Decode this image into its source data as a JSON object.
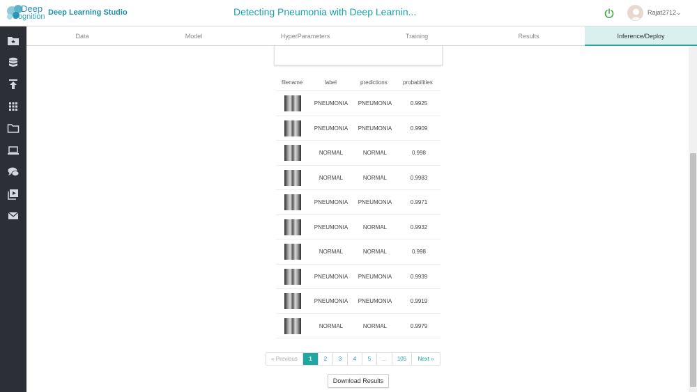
{
  "header": {
    "logo_top": "Deep",
    "logo_bottom": "Cognition",
    "studio_name": "Deep Learning Studio",
    "page_title": "Detecting Pneumonia with Deep Learnin...",
    "username": "Rajat2712",
    "caret": "⌄"
  },
  "sidebar": {
    "icons": [
      "folder-star-icon",
      "database-icon",
      "upload-icon",
      "grid-apps-icon",
      "folder-icon",
      "laptop-icon",
      "chat-icon",
      "video-play-icon",
      "mail-icon"
    ]
  },
  "tabs": {
    "items": [
      {
        "label": "Data"
      },
      {
        "label": "Model"
      },
      {
        "label": "HyperParameters"
      },
      {
        "label": "Training"
      },
      {
        "label": "Results"
      },
      {
        "label": "Inference/Deploy",
        "active": true
      }
    ]
  },
  "table": {
    "headers": [
      "filename",
      "label",
      "predictions",
      "probabilities"
    ],
    "rows": [
      {
        "label": "PNEUMONIA",
        "prediction": "PNEUMONIA",
        "probability": "0.9925"
      },
      {
        "label": "PNEUMONIA",
        "prediction": "PNEUMONIA",
        "probability": "0.9909"
      },
      {
        "label": "NORMAL",
        "prediction": "NORMAL",
        "probability": "0.998"
      },
      {
        "label": "NORMAL",
        "prediction": "NORMAL",
        "probability": "0.9983"
      },
      {
        "label": "PNEUMONIA",
        "prediction": "PNEUMONIA",
        "probability": "0.9971"
      },
      {
        "label": "PNEUMONIA",
        "prediction": "NORMAL",
        "probability": "0.9932"
      },
      {
        "label": "NORMAL",
        "prediction": "NORMAL",
        "probability": "0.998"
      },
      {
        "label": "PNEUMONIA",
        "prediction": "PNEUMONIA",
        "probability": "0.9939"
      },
      {
        "label": "PNEUMONIA",
        "prediction": "PNEUMONIA",
        "probability": "0.9919"
      },
      {
        "label": "NORMAL",
        "prediction": "NORMAL",
        "probability": "0.9979"
      }
    ]
  },
  "pagination": {
    "previous": "« Previous",
    "pages": [
      "1",
      "2",
      "3",
      "4",
      "5",
      "...",
      "105"
    ],
    "next": "Next »",
    "active_page": "1"
  },
  "actions": {
    "download": "Download Results"
  },
  "colors": {
    "accent": "#21a7a2",
    "sidebar_bg": "#2c3036",
    "active_tab_bg": "#d9f0ef"
  }
}
